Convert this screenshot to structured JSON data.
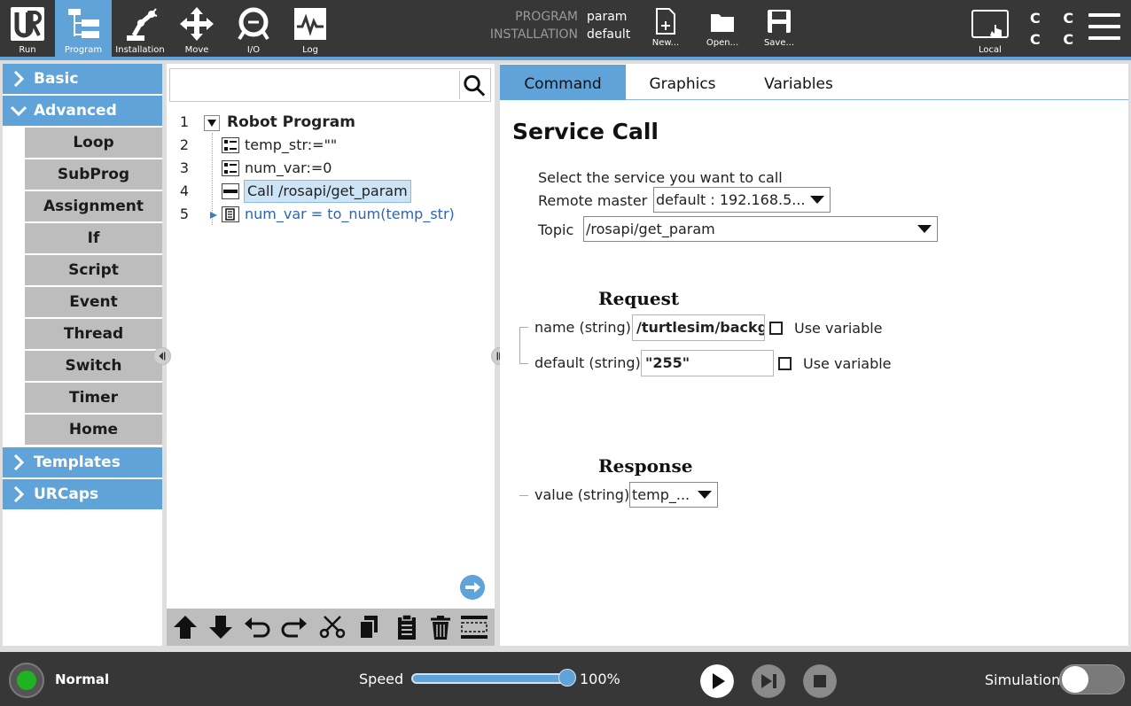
{
  "topbar": {
    "nav": [
      {
        "label": "Run",
        "icon": "ur-logo-icon"
      },
      {
        "label": "Program",
        "icon": "program-icon",
        "active": true
      },
      {
        "label": "Installation",
        "icon": "robot-arm-icon"
      },
      {
        "label": "Move",
        "icon": "move-arrows-icon"
      },
      {
        "label": "I/O",
        "icon": "io-icon"
      },
      {
        "label": "Log",
        "icon": "log-waveform-icon"
      }
    ],
    "program_key": "PROGRAM",
    "program_value": "param",
    "installation_key": "INSTALLATION",
    "installation_value": "default",
    "new_label": "New...",
    "open_label": "Open...",
    "save_label": "Save...",
    "local_label": "Local",
    "cccc": "C C C C"
  },
  "left_panel": {
    "basic": "Basic",
    "advanced": "Advanced",
    "advanced_items": [
      "Loop",
      "SubProg",
      "Assignment",
      "If",
      "Script",
      "Event",
      "Thread",
      "Switch",
      "Timer",
      "Home"
    ],
    "templates": "Templates",
    "urcaps": "URCaps"
  },
  "tree": {
    "search_value": "",
    "rows": [
      {
        "num": "1",
        "text": "Robot Program"
      },
      {
        "num": "2",
        "text": "temp_str:=\"\""
      },
      {
        "num": "3",
        "text": "num_var:=0"
      },
      {
        "num": "4",
        "text": "Call /rosapi/get_param"
      },
      {
        "num": "5",
        "text": "num_var = to_num(temp_str)"
      }
    ]
  },
  "tabs": {
    "command": "Command",
    "graphics": "Graphics",
    "variables": "Variables"
  },
  "command": {
    "title": "Service Call",
    "select_prompt": "Select the service you want to call",
    "remote_master_label": "Remote master",
    "remote_master_value": "default : 192.168.5...",
    "topic_label": "Topic",
    "topic_value": "/rosapi/get_param",
    "request_heading": "Request",
    "name_label": "name (string)",
    "name_value": "/turtlesim/backg",
    "use_variable": "Use variable",
    "default_label": "default (string)",
    "default_value": "\"255\"",
    "response_heading": "Response",
    "value_label": "value (string)",
    "value_value": "temp_..."
  },
  "bottombar": {
    "status": "Normal",
    "speed_label": "Speed",
    "speed_value": "100%",
    "speed_fraction": 1.0,
    "simulation_label": "Simulation"
  },
  "colors": {
    "accent": "#5fa3d9",
    "bar": "#373737",
    "status_ok": "#1fb321"
  }
}
